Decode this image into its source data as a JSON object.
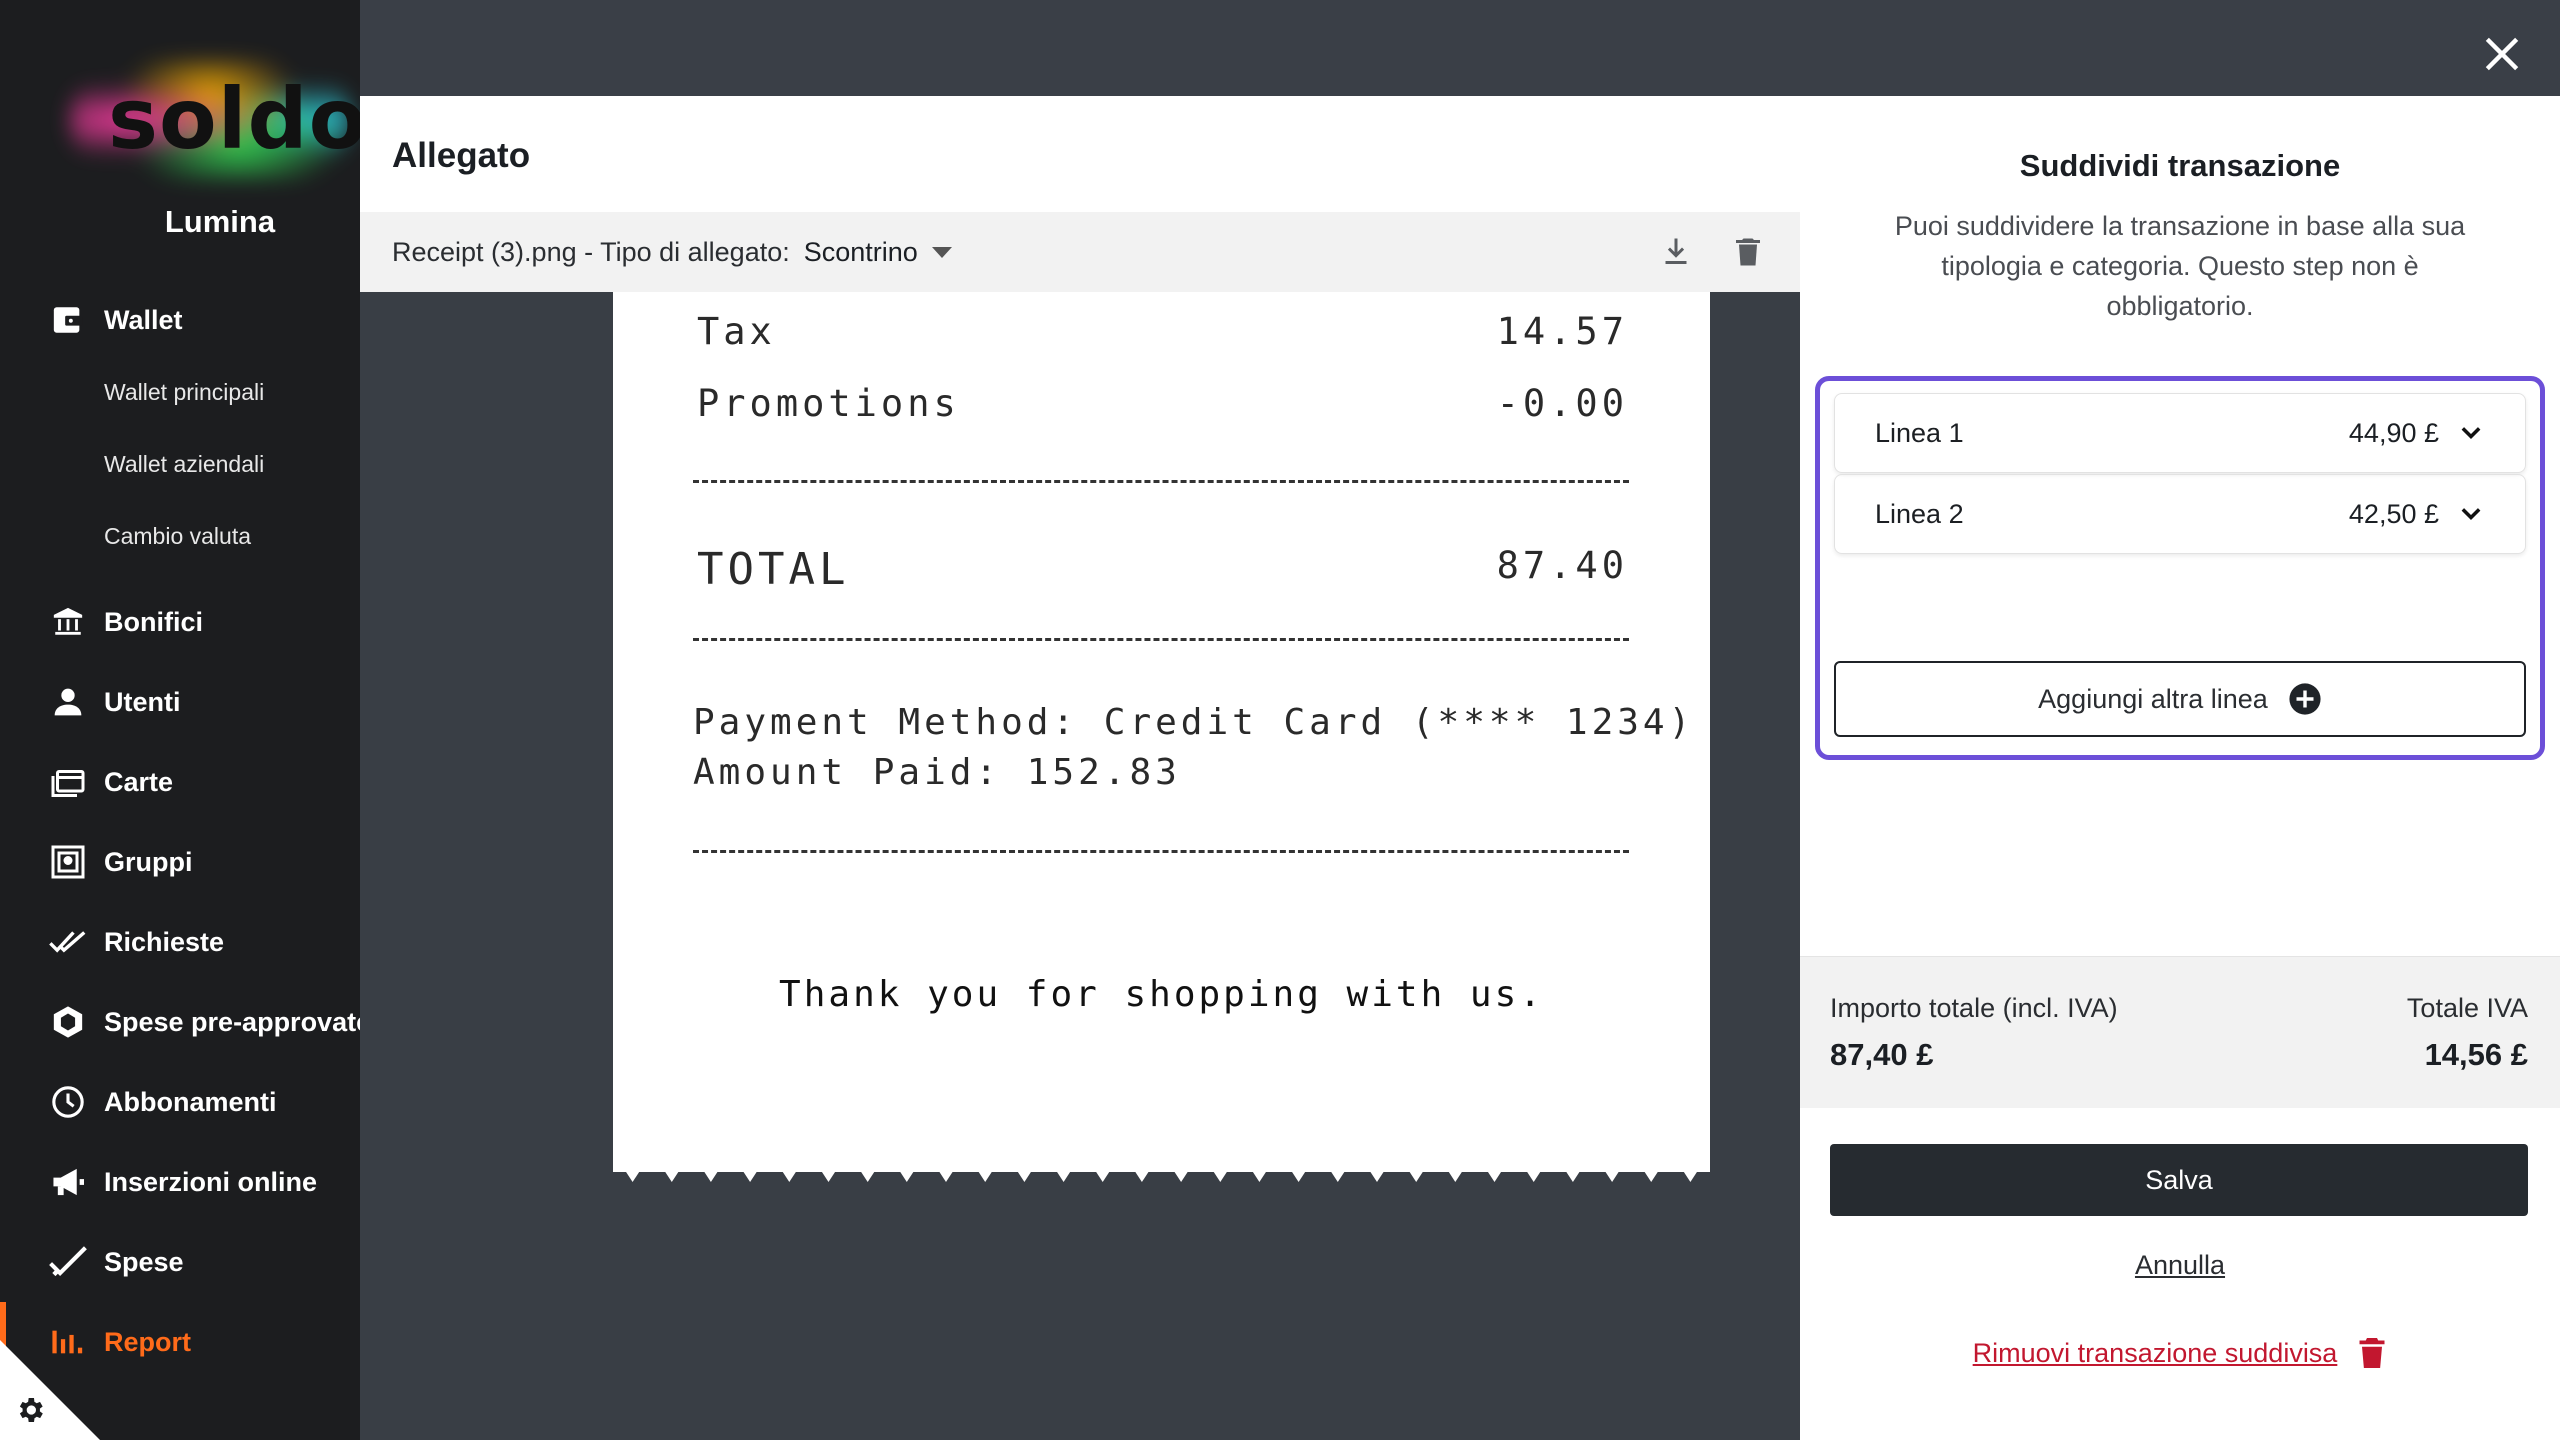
{
  "app": {
    "logo_text": "soldo",
    "org_name": "Lumina"
  },
  "sidebar": {
    "items": [
      {
        "label": "Wallet",
        "icon": "wallet-icon"
      },
      {
        "label": "Wallet principali",
        "sub": true
      },
      {
        "label": "Wallet aziendali",
        "sub": true
      },
      {
        "label": "Cambio valuta",
        "sub": true
      },
      {
        "label": "Bonifici",
        "icon": "bank-icon"
      },
      {
        "label": "Utenti",
        "icon": "user-icon"
      },
      {
        "label": "Carte",
        "icon": "cards-icon"
      },
      {
        "label": "Gruppi",
        "icon": "groups-icon"
      },
      {
        "label": "Richieste",
        "icon": "double-check-icon"
      },
      {
        "label": "Spese pre-approvate",
        "icon": "hexagon-icon"
      },
      {
        "label": "Abbonamenti",
        "icon": "clock-icon"
      },
      {
        "label": "Inserzioni online",
        "icon": "megaphone-icon"
      },
      {
        "label": "Spese",
        "icon": "check-icon"
      },
      {
        "label": "Report",
        "icon": "bar-chart-icon",
        "active": true
      }
    ],
    "active_color": "#ff6b1a"
  },
  "attachment": {
    "title": "Allegato",
    "file_name": "Receipt (3).png - Tipo di allegato:",
    "type_value": "Scontrino"
  },
  "receipt": {
    "tax_label": "Tax",
    "tax_value": "14.57",
    "promo_label": "Promotions",
    "promo_value": "-0.00",
    "total_label": "TOTAL",
    "total_value": "87.40",
    "payment_line": "Payment Method: Credit Card (**** 1234)",
    "paid_line": "Amount Paid: 152.83",
    "thanks": "Thank you for shopping with us."
  },
  "split": {
    "title": "Suddividi transazione",
    "description": "Puoi suddividere la transazione in base alla sua tipologia e categoria. Questo step non è obbligatorio.",
    "lines": [
      {
        "label": "Linea 1",
        "amount": "44,90 £"
      },
      {
        "label": "Linea 2",
        "amount": "42,50 £"
      }
    ],
    "add_line_label": "Aggiungi altra linea",
    "highlight_color": "#6c4fd8"
  },
  "totals": {
    "total_label": "Importo totale (incl. IVA)",
    "total_value": "87,40 £",
    "vat_label": "Totale IVA",
    "vat_value": "14,56 £"
  },
  "actions": {
    "save_label": "Salva",
    "cancel_label": "Annulla",
    "remove_label": "Rimuovi transazione suddivisa"
  }
}
